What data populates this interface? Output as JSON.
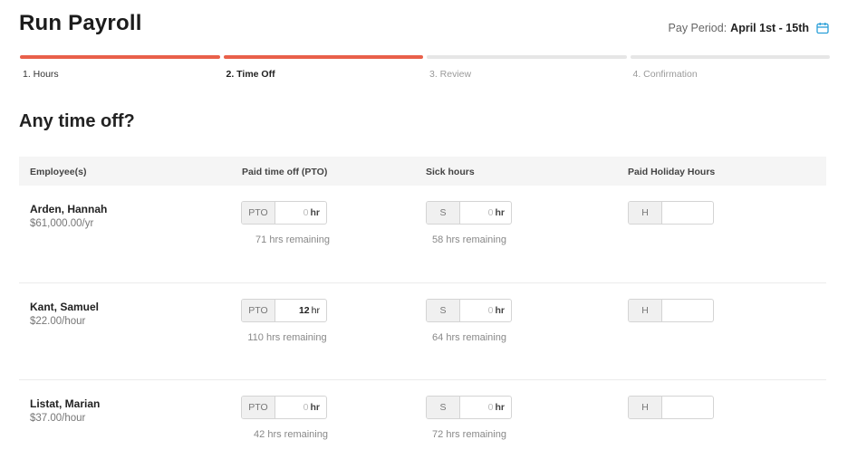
{
  "header": {
    "title": "Run Payroll",
    "pay_period_label": "Pay Period:",
    "pay_period_value": "April 1st - 15th",
    "calendar_icon": "calendar-icon",
    "accent_color": "#e9604a"
  },
  "steps": [
    {
      "label": "1. Hours",
      "state": "done"
    },
    {
      "label": "2. Time Off",
      "state": "active"
    },
    {
      "label": "3. Review",
      "state": "todo"
    },
    {
      "label": "4. Confirmation",
      "state": "todo"
    }
  ],
  "section_title": "Any time off?",
  "table": {
    "headers": [
      "Employee(s)",
      "Paid time off (PTO)",
      "Sick hours",
      "Paid Holiday Hours"
    ],
    "rows": [
      {
        "name": "Arden, Hannah",
        "rate": "$61,000.00/yr",
        "pto": {
          "addon": "PTO",
          "value": "0",
          "unit": "hr",
          "remaining": "71 hrs remaining"
        },
        "sick": {
          "addon": "S",
          "value": "0",
          "unit": "hr",
          "remaining": "58 hrs remaining"
        },
        "holiday": {
          "addon": "H",
          "value": ""
        }
      },
      {
        "name": "Kant, Samuel",
        "rate": "$22.00/hour",
        "pto": {
          "addon": "PTO",
          "value": "12",
          "unit": "hr",
          "remaining": "110 hrs remaining"
        },
        "sick": {
          "addon": "S",
          "value": "0",
          "unit": "hr",
          "remaining": "64 hrs remaining"
        },
        "holiday": {
          "addon": "H",
          "value": ""
        }
      },
      {
        "name": "Listat, Marian",
        "rate": "$37.00/hour",
        "pto": {
          "addon": "PTO",
          "value": "0",
          "unit": "hr",
          "remaining": "42 hrs remaining"
        },
        "sick": {
          "addon": "S",
          "value": "0",
          "unit": "hr",
          "remaining": "72 hrs remaining"
        },
        "holiday": {
          "addon": "H",
          "value": ""
        }
      }
    ]
  }
}
